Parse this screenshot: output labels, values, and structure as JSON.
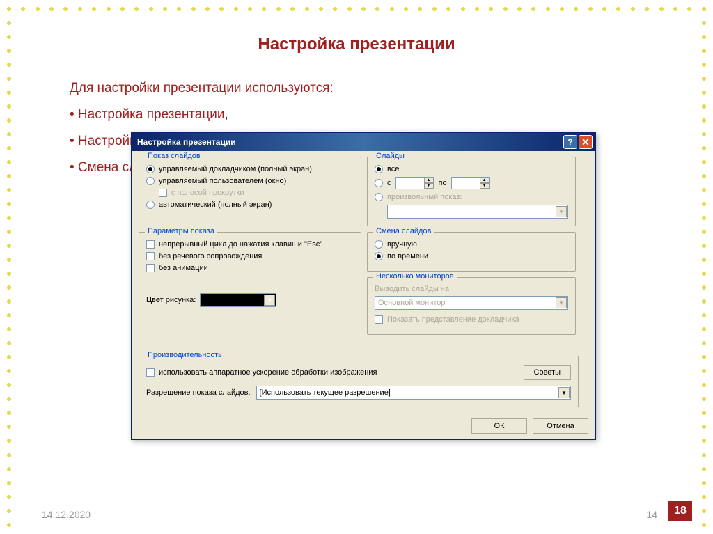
{
  "slide": {
    "title": "Настройка презентации",
    "intro": "Для настройки презентации используются:",
    "items": [
      "• Настройка презентации,",
      "• Настройка времени,",
      "• Смена слайдов"
    ],
    "date": "14.12.2020",
    "page_left": "14",
    "page_badge": "18"
  },
  "dialog": {
    "title": "Настройка презентации",
    "help": "?",
    "close": "✕",
    "show_type": {
      "legend": "Показ слайдов",
      "opt_presenter": "управляемый докладчиком (полный экран)",
      "opt_user": "управляемый пользователем (окно)",
      "opt_scrollbar": "с полосой прокрутки",
      "opt_auto": "автоматический (полный экран)"
    },
    "slides": {
      "legend": "Слайды",
      "opt_all": "все",
      "opt_from": "с",
      "to_label": "по",
      "opt_custom": "произвольный показ:"
    },
    "params": {
      "legend": "Параметры показа",
      "loop": "непрерывный цикл до нажатия клавиши \"Esc\"",
      "no_narration": "без речевого сопровождения",
      "no_animation": "без анимации",
      "pen_color": "Цвет рисунка:"
    },
    "advance": {
      "legend": "Смена слайдов",
      "manual": "вручную",
      "timed": "по времени"
    },
    "monitors": {
      "legend": "Несколько мониторов",
      "output_label": "Выводить слайды на:",
      "primary": "Основной монитор",
      "presenter_view": "Показать представление докладчика"
    },
    "perf": {
      "legend": "Производительность",
      "hw_accel": "использовать аппаратное ускорение обработки изображения",
      "tips": "Советы",
      "resolution_label": "Разрешение показа слайдов:",
      "resolution_value": "[Использовать текущее разрешение]"
    },
    "buttons": {
      "ok": "ОК",
      "cancel": "Отмена"
    }
  }
}
